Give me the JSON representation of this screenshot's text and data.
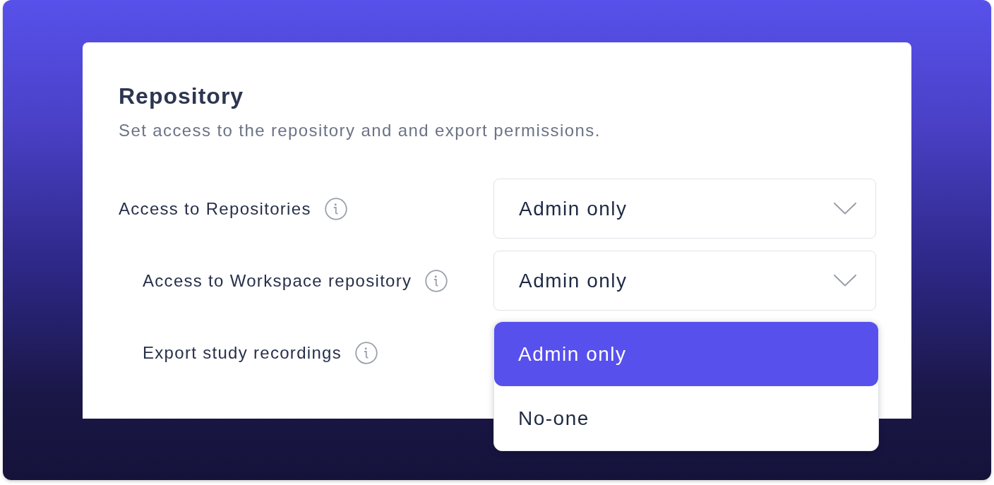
{
  "section": {
    "title": "Repository",
    "description": "Set access to the repository and and export permissions."
  },
  "settings": [
    {
      "label": "Access to Repositories",
      "kind": "select",
      "value": "Admin only",
      "children": [
        {
          "label": "Access to Workspace repository",
          "kind": "select",
          "value": "Admin only"
        },
        {
          "label": "Export study recordings",
          "kind": "open-menu",
          "options": [
            {
              "label": "Admin only",
              "selected": true
            },
            {
              "label": "No-one",
              "selected": false
            }
          ]
        }
      ]
    }
  ]
}
